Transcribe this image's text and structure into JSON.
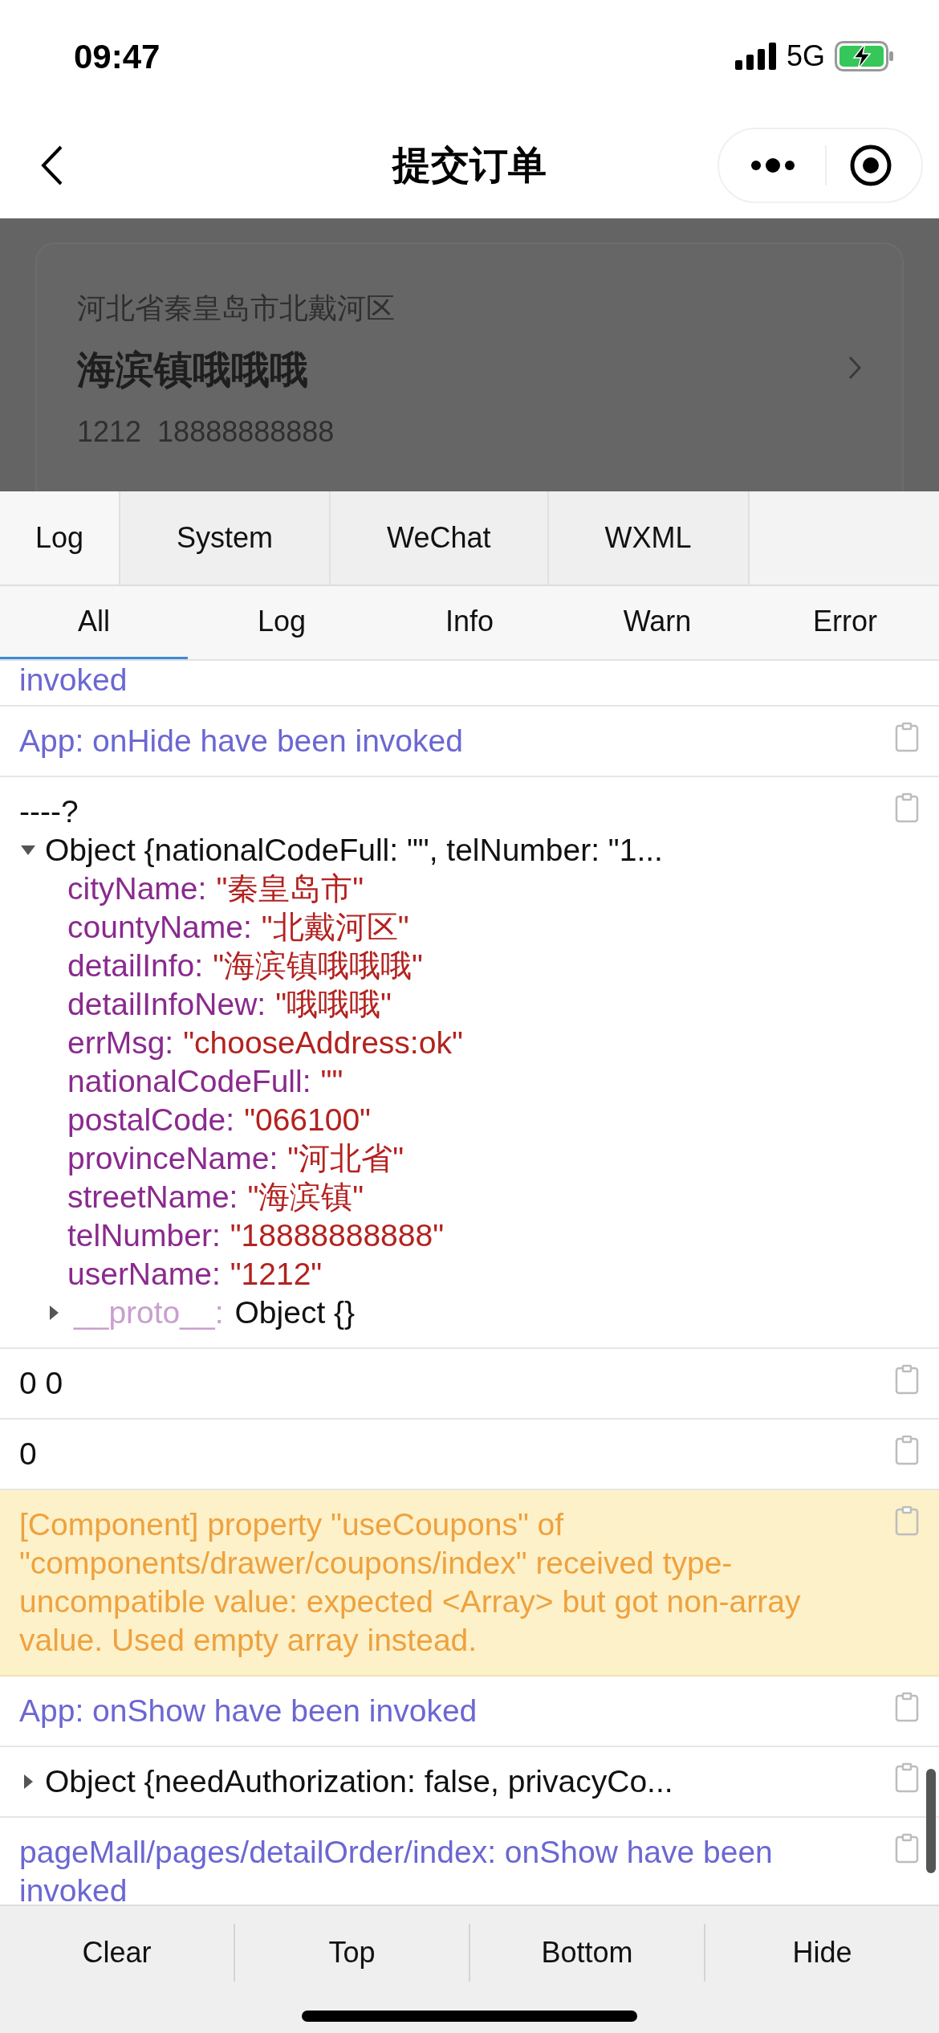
{
  "status_bar": {
    "time": "09:47",
    "network": "5G"
  },
  "nav": {
    "title": "提交订单"
  },
  "address": {
    "region": "河北省秦皇岛市北戴河区",
    "detail": "海滨镇哦哦哦",
    "contact": "1212  18888888888"
  },
  "tabs": [
    {
      "label": "Log",
      "selected": true
    },
    {
      "label": "System",
      "selected": false
    },
    {
      "label": "WeChat",
      "selected": false
    },
    {
      "label": "WXML",
      "selected": false
    }
  ],
  "filters": [
    {
      "label": "All",
      "selected": true
    },
    {
      "label": "Log",
      "selected": false
    },
    {
      "label": "Info",
      "selected": false
    },
    {
      "label": "Warn",
      "selected": false
    },
    {
      "label": "Error",
      "selected": false
    }
  ],
  "logs": [
    {
      "kind": "info",
      "text": "invoked",
      "copyable": false
    },
    {
      "kind": "info",
      "text": "App: onHide have been invoked",
      "copyable": true
    },
    {
      "kind": "object",
      "text": "----?",
      "summary": "Object {nationalCodeFull: \"\", telNumber: \"1...",
      "expanded": true,
      "copyable": true,
      "props": [
        {
          "key": "cityName:",
          "value": "\"秦皇岛市\""
        },
        {
          "key": "countyName:",
          "value": "\"北戴河区\""
        },
        {
          "key": "detailInfo:",
          "value": "\"海滨镇哦哦哦\""
        },
        {
          "key": "detailInfoNew:",
          "value": "\"哦哦哦\""
        },
        {
          "key": "errMsg:",
          "value": "\"chooseAddress:ok\""
        },
        {
          "key": "nationalCodeFull:",
          "value": "\"\""
        },
        {
          "key": "postalCode:",
          "value": "\"066100\""
        },
        {
          "key": "provinceName:",
          "value": "\"河北省\""
        },
        {
          "key": "streetName:",
          "value": "\"海滨镇\""
        },
        {
          "key": "telNumber:",
          "value": "\"18888888888\""
        },
        {
          "key": "userName:",
          "value": "\"1212\""
        }
      ],
      "proto": {
        "key": "__proto__:",
        "value": "Object {}",
        "expanded": false
      }
    },
    {
      "kind": "plain",
      "text": "0 0",
      "copyable": true
    },
    {
      "kind": "plain",
      "text": "0",
      "copyable": true
    },
    {
      "kind": "warn",
      "text": "[Component] property \"useCoupons\" of \"components/drawer/coupons/index\" received type-uncompatible value: expected <Array> but got non-array value. Used empty array instead.",
      "copyable": true
    },
    {
      "kind": "info",
      "text": "App: onShow have been invoked",
      "copyable": true
    },
    {
      "kind": "collapsed",
      "text": "Object {needAuthorization: false, privacyCo...",
      "expanded": false,
      "copyable": true
    },
    {
      "kind": "info",
      "text": "pageMall/pages/detailOrder/index: onShow have been invoked",
      "copyable": true
    }
  ],
  "buttons": [
    "Clear",
    "Top",
    "Bottom",
    "Hide"
  ]
}
